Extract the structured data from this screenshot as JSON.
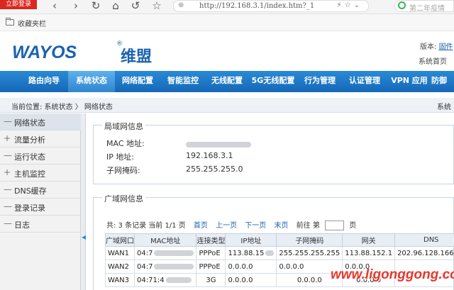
{
  "browser": {
    "login_label": "立即登录",
    "url": "http://192.168.3.1/index.htm?_1",
    "search_text": "第二年疫情"
  },
  "bookmarks": {
    "label": "收藏夹栏"
  },
  "header": {
    "logo": "WAYOS",
    "logo_cn": "维盟",
    "registered": "®",
    "version_label": "版本:",
    "version_value": "固件",
    "home_label": "系统首页"
  },
  "nav": {
    "items": [
      "路由向导",
      "系统状态",
      "网络配置",
      "智能监控",
      "无线配置",
      "5G无线配置",
      "行为管理",
      "认证管理",
      "VPN 应用",
      "防御"
    ],
    "active": "系统状态"
  },
  "breadcrumb": {
    "text": "当前位置: 系统状态  〉 网络状态",
    "right": "系统"
  },
  "sidebar": {
    "items": [
      {
        "sign": "—",
        "label": "网络状态"
      },
      {
        "sign": "+",
        "label": "流量分析"
      },
      {
        "sign": "—",
        "label": "运行状态"
      },
      {
        "sign": "+",
        "label": "主机监控"
      },
      {
        "sign": "—",
        "label": "DNS缓存"
      },
      {
        "sign": "—",
        "label": "登录记录"
      },
      {
        "sign": "—",
        "label": "日志"
      }
    ]
  },
  "lan": {
    "title": "局域网信息",
    "rows": [
      {
        "label": "MAC 地址:",
        "value": ""
      },
      {
        "label": "IP 地址:",
        "value": "192.168.3.1"
      },
      {
        "label": "子网掩码:",
        "value": "255.255.255.0"
      }
    ]
  },
  "wan": {
    "title": "广域网信息",
    "pager": {
      "summary": "共: 3 条记录 当前 1/1 页",
      "first": "首页",
      "prev": "上一页",
      "next": "下一页",
      "last": "末页",
      "goto": "前往 第",
      "page_unit": "页"
    },
    "columns": [
      "广域网口",
      "MAC地址",
      "连接类型",
      "IP地址",
      "子网掩码",
      "网关",
      "DNS"
    ],
    "rows": [
      {
        "port": "WAN1",
        "mac": "04:7",
        "type": "PPPoE",
        "ip": "113.88.15",
        "mask": "255.255.255.255",
        "gw": "113.88.152.1",
        "dns": "202.96.128.166, ..."
      },
      {
        "port": "WAN2",
        "mac": "04:7",
        "type": "PPPoE",
        "ip": "0.0.0.0",
        "mask": "0.0.0.0",
        "gw": "0.0.0.0",
        "dns": ""
      },
      {
        "port": "WAN3",
        "mac": "04:71:4",
        "type": "3G",
        "ip": "0.0.0.0",
        "mask": "0.0.0.0",
        "gw": "0.0.0.0",
        "dns": ""
      }
    ]
  },
  "watermark": "www.ligonggong.com"
}
